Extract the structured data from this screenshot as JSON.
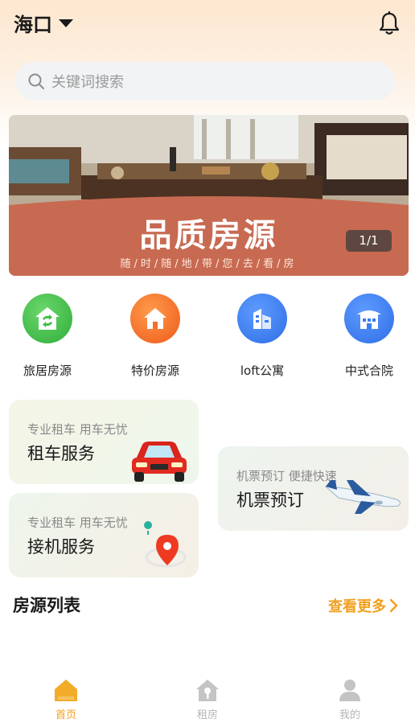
{
  "header": {
    "city": "海口",
    "bell_icon": "bell-icon",
    "caret_icon": "caret-down-icon"
  },
  "search": {
    "placeholder": "关键词搜索",
    "icon": "search-icon"
  },
  "banner": {
    "title": "品质房源",
    "subtitle": "随/时/随/地/带/您/去/看/房",
    "counter": "1/1"
  },
  "quick_links": [
    {
      "label": "旅居房源",
      "icon": "house-swap-icon",
      "color": "#3fbf4a"
    },
    {
      "label": "特价房源",
      "icon": "home-icon",
      "color": "#f5702a"
    },
    {
      "label": "loft公寓",
      "icon": "buildings-icon",
      "color": "#3b7df0"
    },
    {
      "label": "中式合院",
      "icon": "pavilion-icon",
      "color": "#3b7df0"
    }
  ],
  "services": {
    "car_rental": {
      "subtitle": "专业租车 用车无忧",
      "title": "租车服务",
      "icon": "red-car-icon"
    },
    "pickup": {
      "subtitle": "专业租车 用车无忧",
      "title": "接机服务",
      "icon": "map-pin-icon"
    },
    "flight": {
      "subtitle": "机票预订 便捷快速",
      "title": "机票预订",
      "icon": "airplane-icon"
    }
  },
  "listing": {
    "title": "房源列表",
    "more": "查看更多"
  },
  "tabbar": [
    {
      "label": "首页",
      "icon": "home-tab-icon",
      "active": true
    },
    {
      "label": "租房",
      "icon": "house-key-icon",
      "active": false
    },
    {
      "label": "我的",
      "icon": "user-icon",
      "active": false
    }
  ],
  "colors": {
    "accent": "#f0a01e",
    "inactive": "#b5b5b5"
  }
}
